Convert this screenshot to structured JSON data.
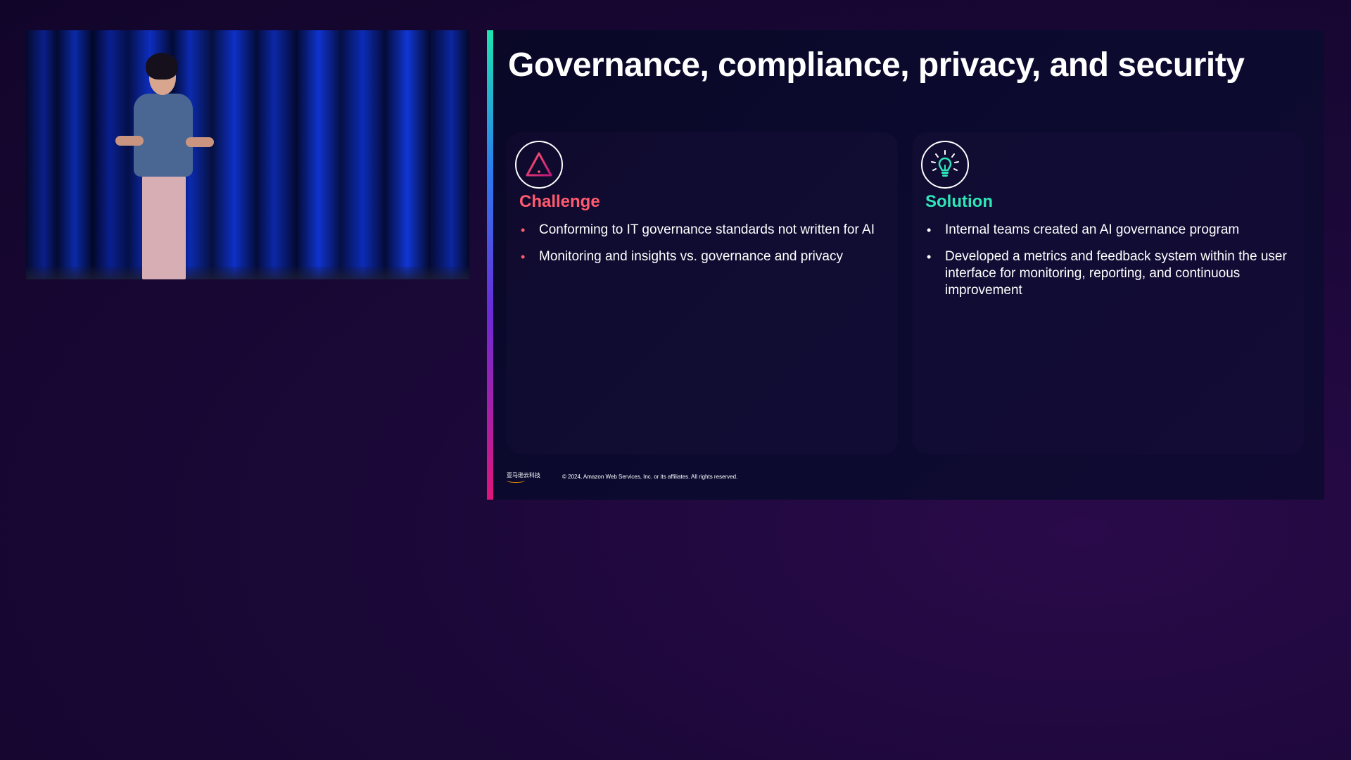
{
  "slide": {
    "title": "Governance, compliance, privacy, and security",
    "accent_colors": [
      "#1de5b0",
      "#2a7cf0",
      "#6a2bd8",
      "#e0157a"
    ],
    "challenge": {
      "icon": "warning-triangle-icon",
      "heading": "Challenge",
      "color": "#ff5a6e",
      "bullets": [
        "Conforming to IT governance standards not written for AI",
        "Monitoring and insights vs. governance and privacy"
      ]
    },
    "solution": {
      "icon": "lightbulb-icon",
      "heading": "Solution",
      "color": "#2ee6b8",
      "bullets": [
        "Internal teams created an AI governance program",
        "Developed a metrics and feedback system within the user interface for monitoring, reporting, and continuous improvement"
      ]
    },
    "footer": {
      "logo_text": "亚马逊云科技",
      "copyright": "© 2024, Amazon Web Services, Inc. or its affiliates. All rights reserved."
    }
  },
  "video": {
    "description_icon": "speaker-video"
  }
}
